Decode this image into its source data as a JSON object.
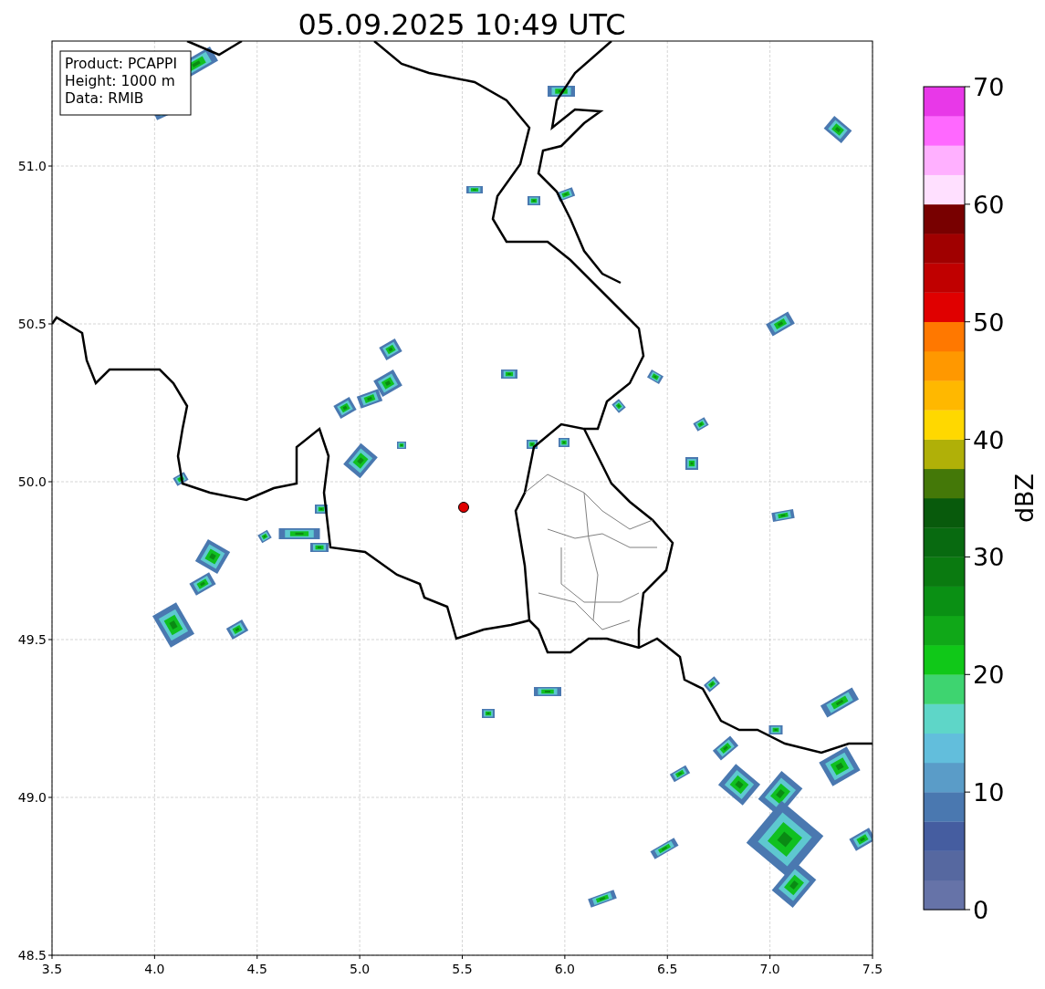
{
  "title": "05.09.2025 10:49 UTC",
  "info_lines": [
    "Product: PCAPPI",
    "Height: 1000 m",
    "Data: RMIB"
  ],
  "x_ticks": [
    "3.5",
    "4.0",
    "4.5",
    "5.0",
    "5.5",
    "6.0",
    "6.5",
    "7.0",
    "7.5"
  ],
  "y_ticks": [
    "51.0",
    "50.5",
    "50.0",
    "49.5",
    "49.0",
    "48.5"
  ],
  "colorbar": {
    "label": "dBZ",
    "ticks": [
      "70",
      "60",
      "50",
      "40",
      "30",
      "20",
      "10",
      "0"
    ],
    "bins": [
      {
        "color": "#6673a8"
      },
      {
        "color": "#5668a0"
      },
      {
        "color": "#455da0"
      },
      {
        "color": "#4a78b0"
      },
      {
        "color": "#5a9cc8"
      },
      {
        "color": "#62bedc"
      },
      {
        "color": "#5ed6c8"
      },
      {
        "color": "#3ed470"
      },
      {
        "color": "#10c818"
      },
      {
        "color": "#10a818"
      },
      {
        "color": "#0a9014"
      },
      {
        "color": "#0a7a10"
      },
      {
        "color": "#086a10"
      },
      {
        "color": "#085a0c"
      },
      {
        "color": "#447808"
      },
      {
        "color": "#b0b008"
      },
      {
        "color": "#ffd800"
      },
      {
        "color": "#ffb800"
      },
      {
        "color": "#ff9800"
      },
      {
        "color": "#ff7800"
      },
      {
        "color": "#e00000"
      },
      {
        "color": "#c00000"
      },
      {
        "color": "#a00000"
      },
      {
        "color": "#780000"
      },
      {
        "color": "#ffe0ff"
      },
      {
        "color": "#ffb0ff"
      },
      {
        "color": "#ff68ff"
      },
      {
        "color": "#e838e8"
      }
    ]
  }
}
